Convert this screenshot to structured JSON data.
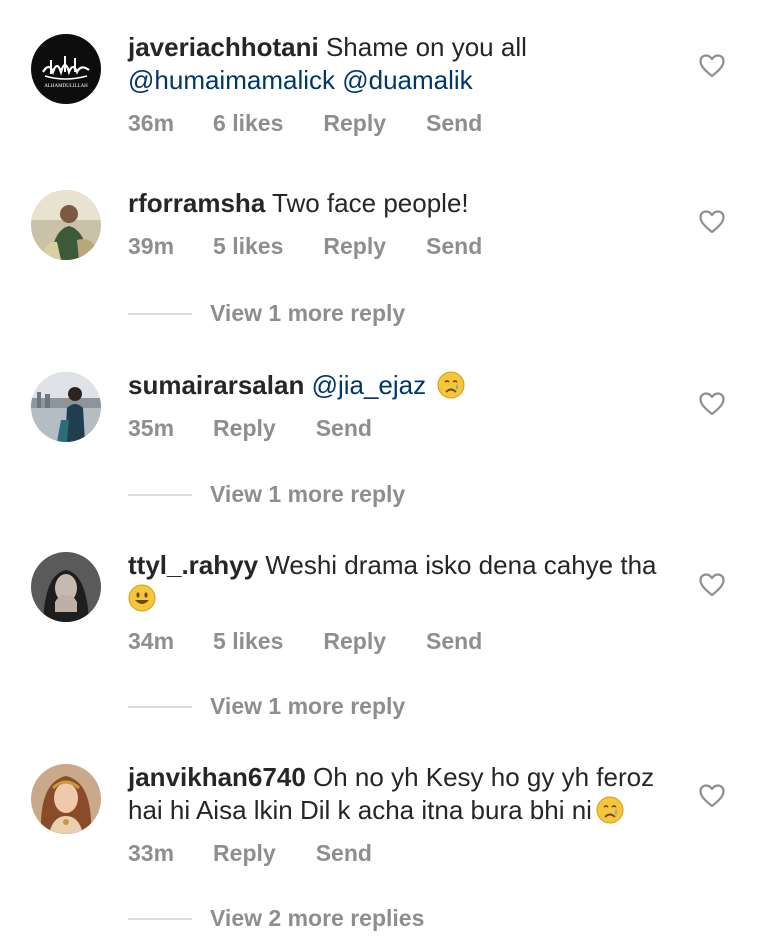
{
  "comments": [
    {
      "username": "javeriachhotani",
      "text": "Shame on you all",
      "mentions": "@humaimamalick @duamalik",
      "time": "36m",
      "likes": "6 likes",
      "reply": "Reply",
      "send": "Send",
      "avatar_icon": "alhamdulillah-calligraphy-avatar",
      "avatar_caption": "ALHAMDULILLAH"
    },
    {
      "username": "rforramsha",
      "text": "Two face people!",
      "time": "39m",
      "likes": "5 likes",
      "reply": "Reply",
      "send": "Send",
      "more_replies": "View 1 more reply",
      "avatar_icon": "user-photo-avatar"
    },
    {
      "username": "sumairarsalan",
      "mention": "@jia_ejaz",
      "emoji": "crying-face-emoji",
      "time": "35m",
      "reply": "Reply",
      "send": "Send",
      "more_replies": "View 1 more reply",
      "avatar_icon": "user-photo-avatar"
    },
    {
      "username": "ttyl_.rahyy",
      "text": "Weshi drama isko dena cahye tha",
      "emoji": "grinning-face-emoji",
      "time": "34m",
      "likes": "5 likes",
      "reply": "Reply",
      "send": "Send",
      "more_replies": "View 1 more reply",
      "avatar_icon": "user-photo-avatar"
    },
    {
      "username": "janvikhan6740",
      "text": "Oh no yh Kesy ho gy yh feroz hai hi Aisa lkin Dil k acha itna bura bhi ni",
      "emoji": "crying-face-emoji",
      "time": "33m",
      "reply": "Reply",
      "send": "Send",
      "more_replies": "View 2 more replies",
      "avatar_icon": "user-photo-avatar"
    }
  ],
  "colors": {
    "text": "#262626",
    "meta": "#8e8e8e",
    "mention": "#00376b",
    "divider": "#dbdbdb"
  }
}
